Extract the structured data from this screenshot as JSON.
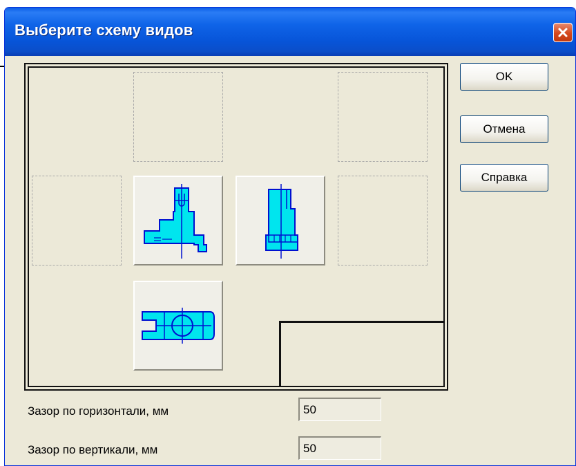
{
  "window": {
    "title": "Выберите схему видов"
  },
  "buttons": {
    "ok": "OK",
    "cancel": "Отмена",
    "help": "Справка"
  },
  "fields": [
    {
      "label": "Зазор по горизонтали, мм",
      "value": "50"
    },
    {
      "label": "Зазор по вертикали, мм",
      "value": "50"
    }
  ],
  "colors": {
    "part_fill": "#00e5ee",
    "part_outline": "#0010d0",
    "titlebar": "#0a5de6"
  }
}
